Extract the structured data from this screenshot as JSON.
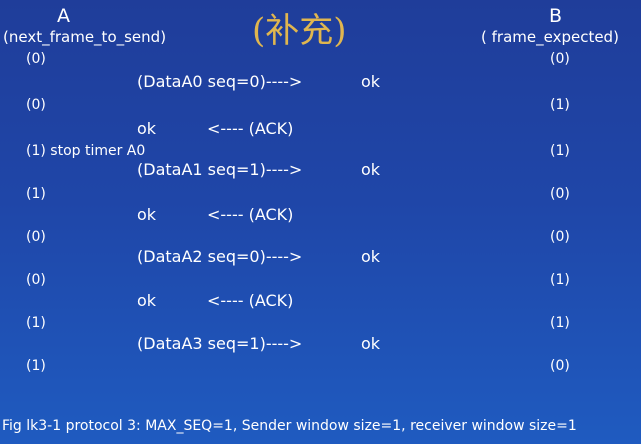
{
  "header": {
    "left_title": "A",
    "left_sub": "(next_frame_to_send)",
    "center_title": "(补充)",
    "right_title": "B",
    "right_sub": "( frame_expected)"
  },
  "sender_states": [
    "(0)",
    "(0)",
    "(1) stop timer A0",
    "(1)",
    "(0)",
    "(0)",
    "(1)",
    "(1)"
  ],
  "receiver_states": [
    "(0)",
    "(1)",
    "(1)",
    "(0)",
    "(0)",
    "(1)",
    "(1)",
    "(0)"
  ],
  "messages": [
    {
      "left": "(DataA0 seq=0)---->",
      "right": "ok"
    },
    {
      "left": "ok",
      "right": "<---- (ACK)"
    },
    {
      "left": "(DataA1 seq=1)---->",
      "right": "ok"
    },
    {
      "left": "ok",
      "right": "<---- (ACK)"
    },
    {
      "left": "(DataA2 seq=0)---->",
      "right": "ok"
    },
    {
      "left": "ok",
      "right": "<---- (ACK)"
    },
    {
      "left": "(DataA3 seq=1)---->",
      "right": "ok"
    }
  ],
  "caption": "Fig lk3-1   protocol 3: MAX_SEQ=1, Sender window size=1, receiver  window size=1"
}
